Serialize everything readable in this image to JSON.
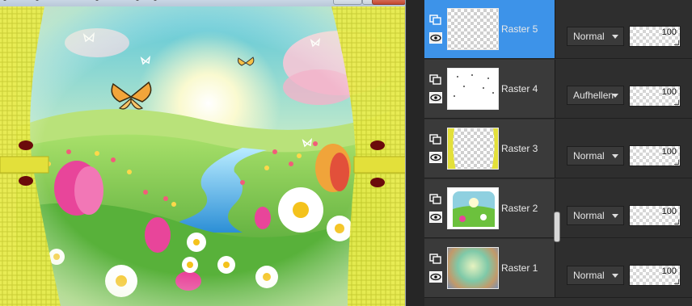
{
  "layers_panel": {
    "layers": [
      {
        "name": "Raster 5",
        "blend_mode": "Normal",
        "opacity": "100",
        "selected": true,
        "thumbnail": "transparent-empty"
      },
      {
        "name": "Raster 4",
        "blend_mode": "Aufhellen",
        "opacity": "100",
        "selected": false,
        "thumbnail": "sparkles"
      },
      {
        "name": "Raster 3",
        "blend_mode": "Normal",
        "opacity": "100",
        "selected": false,
        "thumbnail": "yellow-curtains"
      },
      {
        "name": "Raster 2",
        "blend_mode": "Normal",
        "opacity": "100",
        "selected": false,
        "thumbnail": "spring-scene"
      },
      {
        "name": "Raster 1",
        "blend_mode": "Normal",
        "opacity": "100",
        "selected": false,
        "thumbnail": "swirl-background"
      }
    ],
    "icons": {
      "group": "layer-group-icon",
      "visibility": "eye-icon"
    }
  },
  "canvas": {
    "content": "spring-meadow-artwork"
  },
  "colors": {
    "selection": "#3d93e9",
    "panel_bg": "#2f2f2f",
    "row_bg": "#3a3a3a"
  }
}
